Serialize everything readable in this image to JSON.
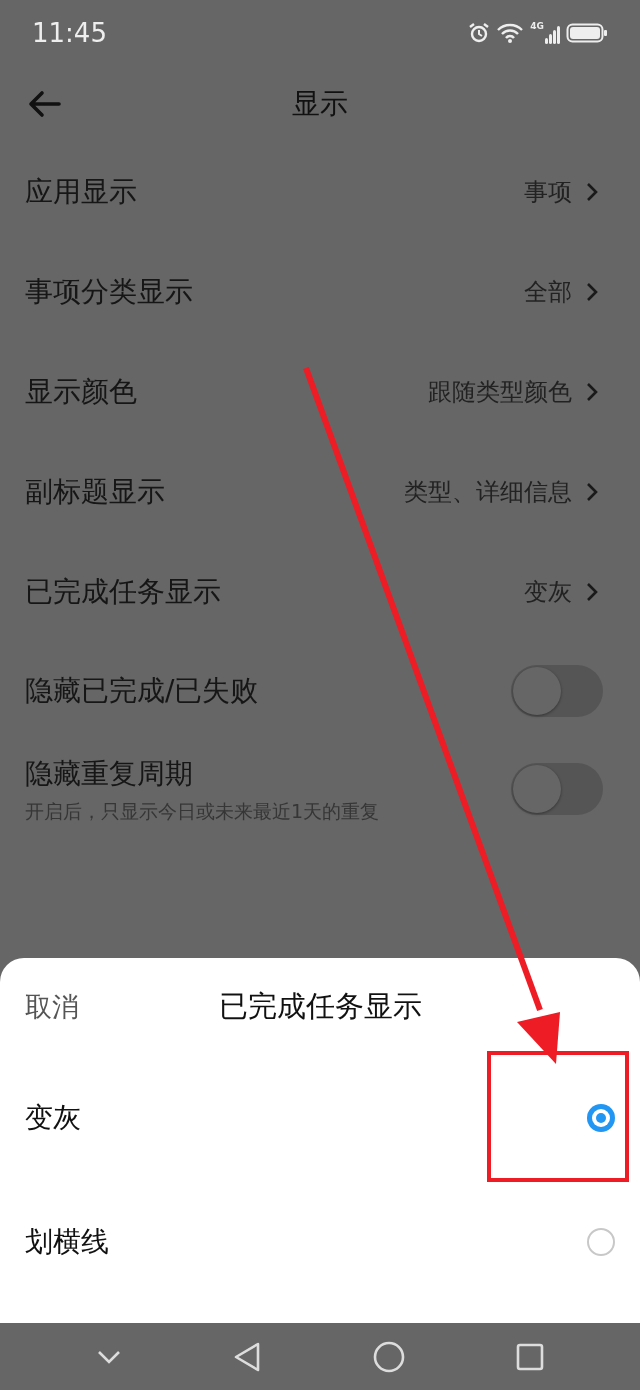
{
  "status_bar": {
    "time": "11:45",
    "network": "4G"
  },
  "header": {
    "title": "显示"
  },
  "settings": [
    {
      "kind": "link",
      "label": "应用显示",
      "value": "事项"
    },
    {
      "kind": "link",
      "label": "事项分类显示",
      "value": "全部"
    },
    {
      "kind": "link",
      "label": "显示颜色",
      "value": "跟随类型颜色"
    },
    {
      "kind": "link",
      "label": "副标题显示",
      "value": "类型、详细信息"
    },
    {
      "kind": "link",
      "label": "已完成任务显示",
      "value": "变灰"
    },
    {
      "kind": "toggle",
      "label": "隐藏已完成/已失败",
      "on": false
    },
    {
      "kind": "toggle",
      "label": "隐藏重复周期",
      "subtitle": "开启后，只显示今日或未来最近1天的重复",
      "on": false
    }
  ],
  "sheet": {
    "cancel": "取消",
    "title": "已完成任务显示",
    "options": [
      {
        "label": "变灰",
        "selected": true
      },
      {
        "label": "划横线",
        "selected": false
      }
    ]
  }
}
